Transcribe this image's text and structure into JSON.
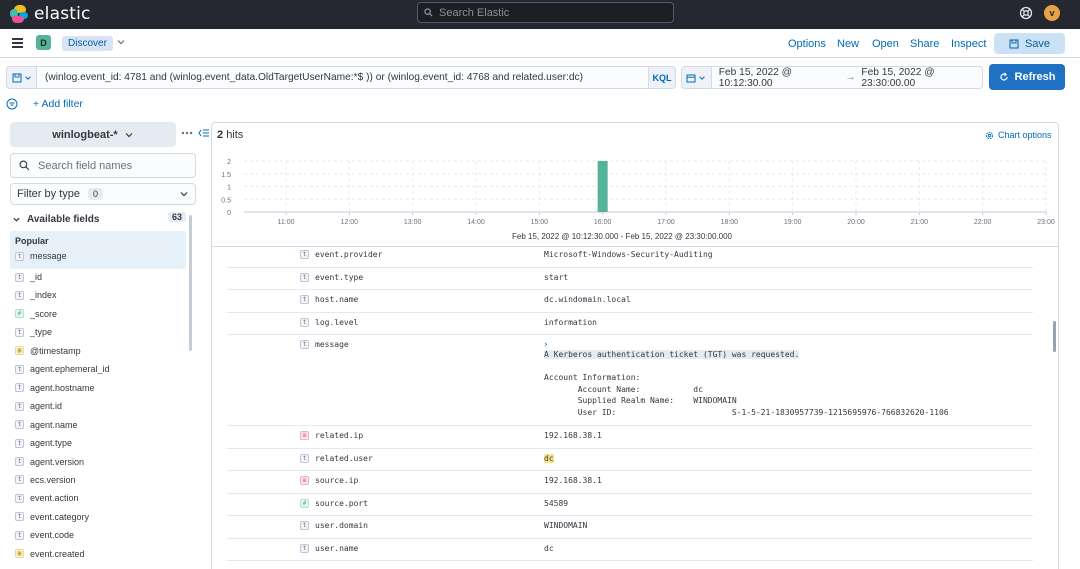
{
  "header": {
    "brand": "elastic",
    "search_placeholder": "Search Elastic",
    "avatar_initial": "v"
  },
  "appbar": {
    "space_initial": "D",
    "breadcrumb": "Discover",
    "nav": [
      "Options",
      "New",
      "Open",
      "Share",
      "Inspect"
    ],
    "save_label": "Save"
  },
  "query": {
    "text": "(winlog.event_id: 4781 and (winlog.event_data.OldTargetUserName:*$ )) or (winlog.event_id: 4768 and related.user:dc)",
    "language": "KQL",
    "date_start": "Feb 15, 2022 @ 10:12:30.00",
    "date_end": "Feb 15, 2022 @ 23:30:00.00",
    "refresh_label": "Refresh",
    "add_filter": "+ Add filter"
  },
  "sidebar": {
    "index_pattern": "winlogbeat-*",
    "field_search_placeholder": "Search field names",
    "filter_by_type": "Filter by type",
    "filter_count": "0",
    "available_label": "Available fields",
    "available_count": "63",
    "popular_label": "Popular",
    "popular_fields": [
      {
        "type": "t",
        "name": "message"
      }
    ],
    "fields": [
      {
        "type": "t",
        "name": "_id"
      },
      {
        "type": "t",
        "name": "_index"
      },
      {
        "type": "#",
        "name": "_score"
      },
      {
        "type": "t",
        "name": "_type"
      },
      {
        "type": "date",
        "name": "@timestamp"
      },
      {
        "type": "t",
        "name": "agent.ephemeral_id"
      },
      {
        "type": "t",
        "name": "agent.hostname"
      },
      {
        "type": "t",
        "name": "agent.id"
      },
      {
        "type": "t",
        "name": "agent.name"
      },
      {
        "type": "t",
        "name": "agent.type"
      },
      {
        "type": "t",
        "name": "agent.version"
      },
      {
        "type": "t",
        "name": "ecs.version"
      },
      {
        "type": "t",
        "name": "event.action"
      },
      {
        "type": "t",
        "name": "event.category"
      },
      {
        "type": "t",
        "name": "event.code"
      },
      {
        "type": "date",
        "name": "event.created"
      }
    ]
  },
  "main": {
    "hits_count": "2",
    "hits_label": "hits",
    "chart_options": "Chart options",
    "range_label": "Feb 15, 2022 @ 10:12:30.000 - Feb 15, 2022 @ 23:30:00.000"
  },
  "chart_data": {
    "type": "bar",
    "categories": [
      "11:00",
      "12:00",
      "13:00",
      "14:00",
      "15:00",
      "16:00",
      "17:00",
      "18:00",
      "19:00",
      "20:00",
      "21:00",
      "22:00",
      "23:00"
    ],
    "bars": [
      {
        "x": "16:00",
        "value": 2
      }
    ],
    "y_ticks": [
      "0",
      "0.5",
      "1",
      "1.5",
      "2"
    ],
    "ylim": [
      0,
      2
    ],
    "grid": true,
    "bar_color": "#54b399"
  },
  "doc": {
    "rows": [
      {
        "type": "t",
        "field": "event.provider",
        "value": "Microsoft-Windows-Security-Auditing"
      },
      {
        "type": "t",
        "field": "event.type",
        "value": "start"
      },
      {
        "type": "t",
        "field": "host.name",
        "value": "dc.windomain.local"
      },
      {
        "type": "t",
        "field": "log.level",
        "value": "information"
      },
      {
        "type": "t",
        "field": "message",
        "value_lines": [
          "A Kerberos authentication ticket (TGT) was requested.",
          "",
          "Account Information:",
          "       Account Name:           dc",
          "       Supplied Realm Name:    WINDOMAIN",
          "       User ID:                        S-1-5-21-1830957739-1215695976-766832620-1106"
        ]
      },
      {
        "type": "ip",
        "field": "related.ip",
        "value": "192.168.38.1"
      },
      {
        "type": "t",
        "field": "related.user",
        "value": "dc"
      },
      {
        "type": "ip",
        "field": "source.ip",
        "value": "192.168.38.1"
      },
      {
        "type": "#",
        "field": "source.port",
        "value": "54589"
      },
      {
        "type": "t",
        "field": "user.domain",
        "value": "WINDOMAIN"
      },
      {
        "type": "t",
        "field": "user.name",
        "value": "dc"
      }
    ]
  }
}
